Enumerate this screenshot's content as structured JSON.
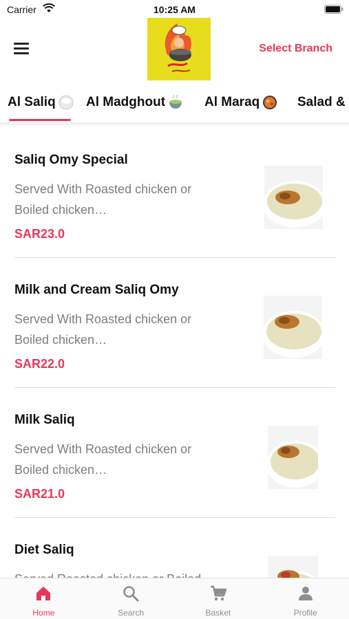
{
  "status_bar": {
    "carrier": "Carrier",
    "time": "10:25 AM"
  },
  "header": {
    "select_branch_label": "Select Branch",
    "logo_icon": "chef-logo-icon"
  },
  "tabs": [
    {
      "label": "Al Saliq",
      "icon": "rice-bowl-icon",
      "active": true
    },
    {
      "label": "Al Madghout",
      "icon": "soup-bowl-icon",
      "active": false
    },
    {
      "label": "Al Maraq",
      "icon": "stew-pan-icon",
      "active": false
    },
    {
      "label": "Salad &",
      "icon": "",
      "active": false
    }
  ],
  "menu_items": [
    {
      "name": "Saliq Omy Special",
      "description": "Served With Roasted chicken or Boiled chicken…",
      "price": "SAR23.0"
    },
    {
      "name": "Milk and Cream Saliq Omy",
      "description": "Served With Roasted chicken or Boiled chicken…",
      "price": "SAR22.0"
    },
    {
      "name": "Milk Saliq",
      "description": "Served With Roasted chicken or Boiled chicken…",
      "price": "SAR21.0"
    },
    {
      "name": "Diet Saliq",
      "description": "Served Roasted chicken or Boiled",
      "price": ""
    }
  ],
  "bottom_nav": [
    {
      "label": "Home",
      "icon": "home-icon",
      "active": true
    },
    {
      "label": "Search",
      "icon": "search-icon",
      "active": false
    },
    {
      "label": "Basket",
      "icon": "cart-icon",
      "active": false
    },
    {
      "label": "Profile",
      "icon": "profile-icon",
      "active": false
    }
  ],
  "colors": {
    "accent": "#e8375a",
    "logo_background": "#e8dd1d",
    "muted_text": "#7d7d7d"
  }
}
